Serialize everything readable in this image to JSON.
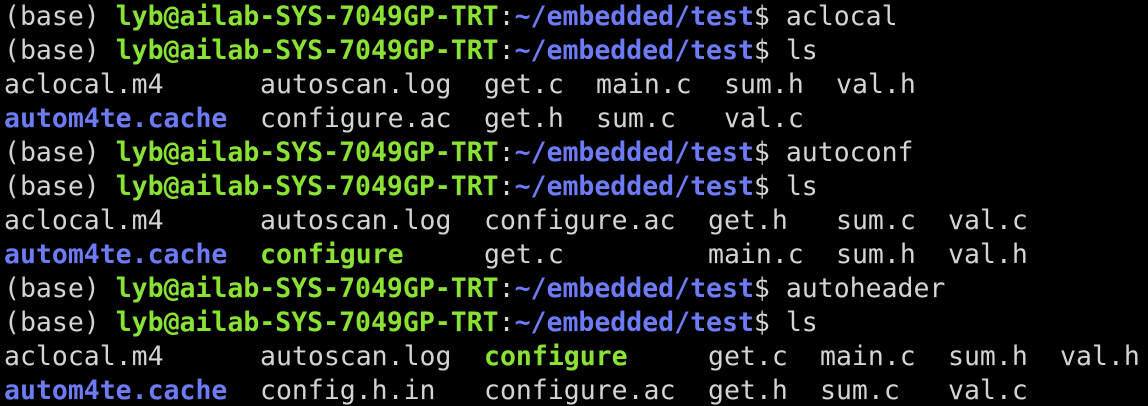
{
  "prompt": {
    "env": "(base)",
    "user_host": "lyb@ailab-SYS-7049GP-TRT",
    "colon": ":",
    "path": "~/embedded/test",
    "sign": "$"
  },
  "colors": {
    "background": "#000000",
    "text": "#d4d4d4",
    "user_host": "#8ae234",
    "path": "#6d7cf6",
    "directory": "#6d7cf6",
    "executable": "#8ae234"
  },
  "commands": [
    "aclocal",
    "ls",
    "autoconf",
    "ls",
    "autoheader",
    "ls"
  ],
  "ls_outputs": [
    {
      "rows": [
        [
          {
            "name": "aclocal.m4",
            "type": "file"
          },
          {
            "name": "autoscan.log",
            "type": "file"
          },
          {
            "name": "get.c",
            "type": "file"
          },
          {
            "name": "main.c",
            "type": "file"
          },
          {
            "name": "sum.h",
            "type": "file"
          },
          {
            "name": "val.h",
            "type": "file"
          }
        ],
        [
          {
            "name": "autom4te.cache",
            "type": "dir"
          },
          {
            "name": "configure.ac",
            "type": "file"
          },
          {
            "name": "get.h",
            "type": "file"
          },
          {
            "name": "sum.c",
            "type": "file"
          },
          {
            "name": "val.c",
            "type": "file"
          }
        ]
      ]
    },
    {
      "rows": [
        [
          {
            "name": "aclocal.m4",
            "type": "file"
          },
          {
            "name": "autoscan.log",
            "type": "file"
          },
          {
            "name": "configure.ac",
            "type": "file"
          },
          {
            "name": "get.h",
            "type": "file"
          },
          {
            "name": "sum.c",
            "type": "file"
          },
          {
            "name": "val.c",
            "type": "file"
          }
        ],
        [
          {
            "name": "autom4te.cache",
            "type": "dir"
          },
          {
            "name": "configure",
            "type": "exe"
          },
          {
            "name": "get.c",
            "type": "file"
          },
          {
            "name": "main.c",
            "type": "file"
          },
          {
            "name": "sum.h",
            "type": "file"
          },
          {
            "name": "val.h",
            "type": "file"
          }
        ]
      ]
    },
    {
      "rows": [
        [
          {
            "name": "aclocal.m4",
            "type": "file"
          },
          {
            "name": "autoscan.log",
            "type": "file"
          },
          {
            "name": "configure",
            "type": "exe"
          },
          {
            "name": "get.c",
            "type": "file"
          },
          {
            "name": "main.c",
            "type": "file"
          },
          {
            "name": "sum.h",
            "type": "file"
          },
          {
            "name": "val.h",
            "type": "file"
          }
        ],
        [
          {
            "name": "autom4te.cache",
            "type": "dir"
          },
          {
            "name": "config.h.in",
            "type": "file"
          },
          {
            "name": "configure.ac",
            "type": "file"
          },
          {
            "name": "get.h",
            "type": "file"
          },
          {
            "name": "sum.c",
            "type": "file"
          },
          {
            "name": "val.c",
            "type": "file"
          }
        ]
      ]
    }
  ]
}
